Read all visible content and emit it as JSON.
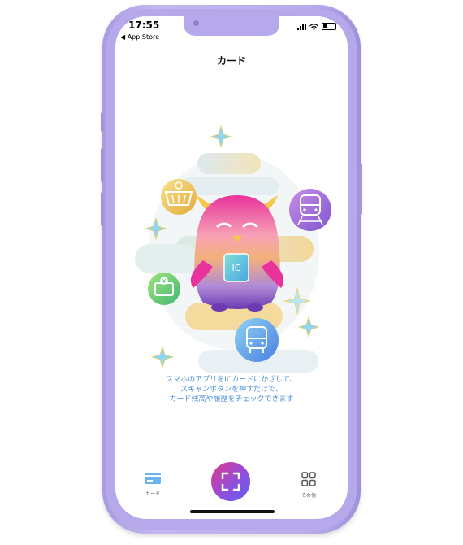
{
  "status_bar": {
    "time": "17:55",
    "back_label": "◀ App Store"
  },
  "header": {
    "title": "カード"
  },
  "hero": {
    "chip_label": "IC"
  },
  "message": {
    "lines": [
      "スマホのアプリをICカードにかざして、",
      "スキャンボタンを押すだけで、",
      "カード残高や履歴をチェックできます"
    ]
  },
  "tabbar": {
    "cards_label": "カード",
    "other_label": "その他"
  },
  "colors": {
    "frame": "#b6a8ea",
    "accent_blue": "#4a8fd4",
    "scan_gradient_start": "#e03a8c",
    "scan_gradient_end": "#5b63ea"
  }
}
